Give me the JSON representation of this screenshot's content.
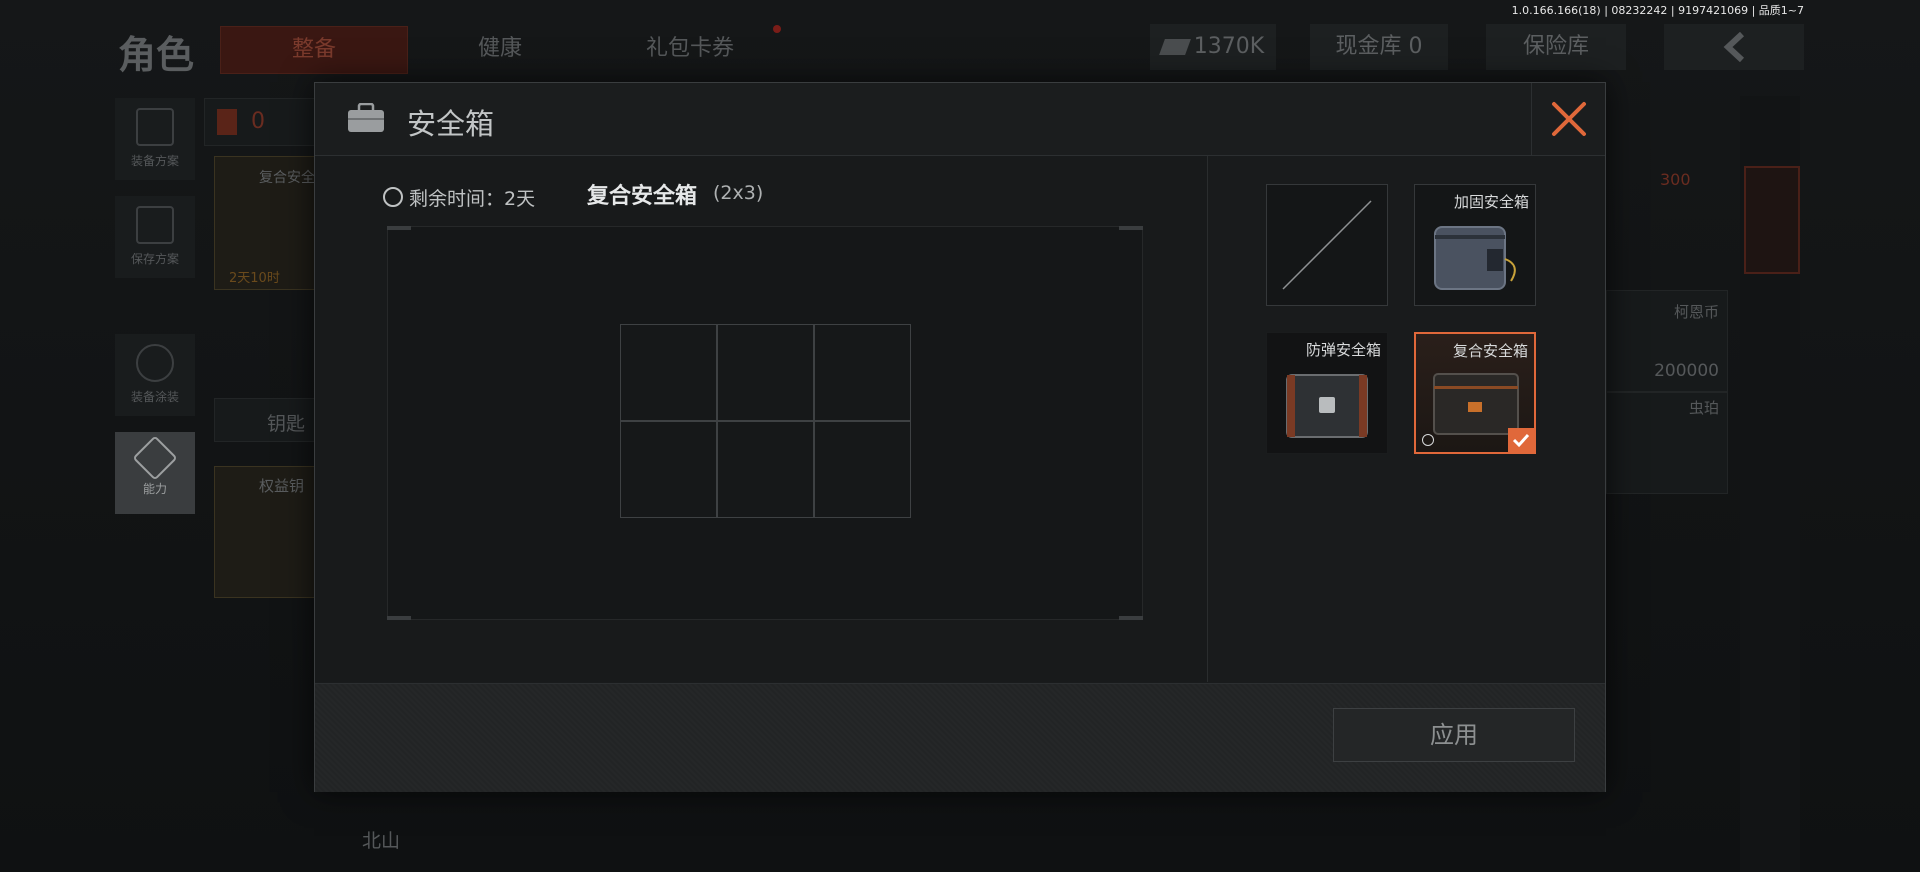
{
  "version_text": "1.0.166.166(18) | 08232242 | 9197421069 | 品质1~7",
  "background": {
    "title": "角色",
    "tabs": [
      {
        "label": "整备",
        "active": true
      },
      {
        "label": "健康",
        "active": false
      },
      {
        "label": "礼包卡券",
        "active": false
      }
    ],
    "currency": "1370K",
    "cash_vault": "现金库 0",
    "insurance": "保险库",
    "left_menu": [
      {
        "label": "装备方案",
        "icon": "vest-icon"
      },
      {
        "label": "保存方案",
        "icon": "download-icon"
      },
      {
        "label": "装备涂装",
        "icon": "helmet-icon"
      },
      {
        "label": "能力",
        "icon": "lightning-icon"
      }
    ],
    "equip_count": "0",
    "secure_box_label": "复合安全",
    "secure_box_time": "2天10时",
    "key_label": "钥匙",
    "key_item_label": "权益钥",
    "value_300": "300",
    "coin_name": "柯恩币",
    "coin_amount": "200000",
    "amber_name": "虫珀",
    "bottom_text": "北山"
  },
  "modal": {
    "title": "安全箱",
    "timer_label": "剩余时间：",
    "timer_value": "2天",
    "selected_box_name": "复合安全箱",
    "selected_box_size": "(2x3)",
    "grid": {
      "rows": 2,
      "cols": 3
    },
    "options": [
      {
        "label": "",
        "type": "empty"
      },
      {
        "label": "加固安全箱",
        "type": "reinforced"
      },
      {
        "label": "防弹安全箱",
        "type": "bulletproof"
      },
      {
        "label": "复合安全箱",
        "type": "composite",
        "selected": true
      }
    ],
    "apply_label": "应用",
    "accent": "#e0683a"
  }
}
